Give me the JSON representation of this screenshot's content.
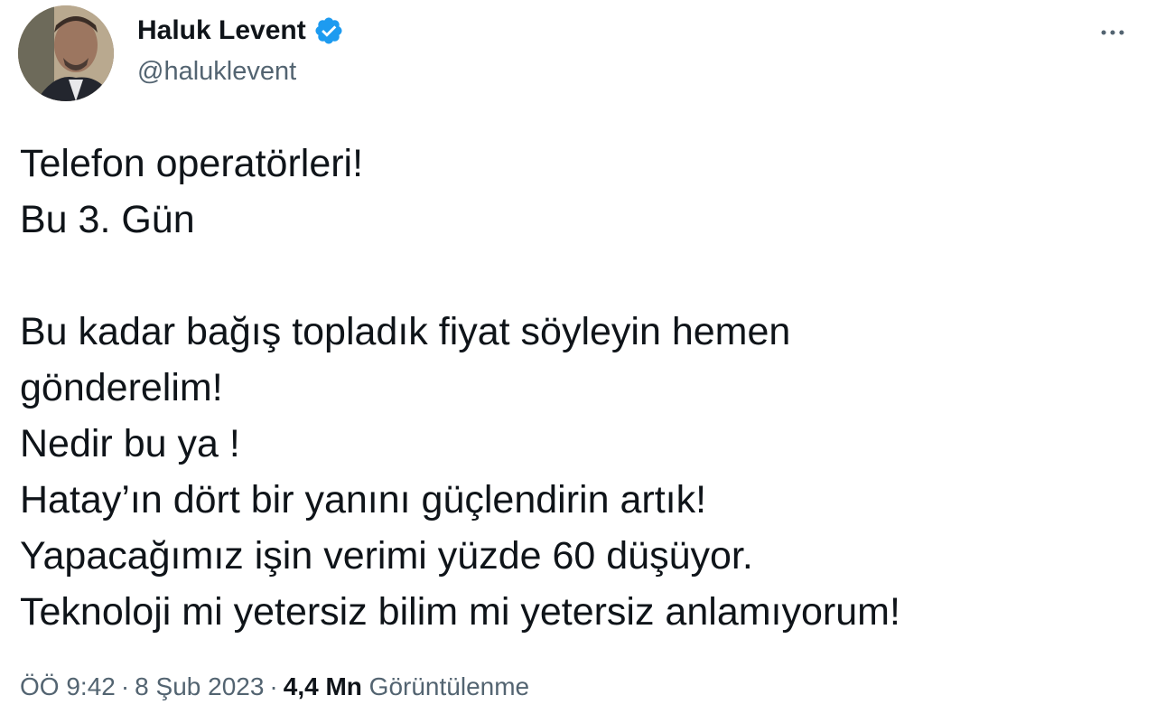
{
  "author": {
    "name": "Haluk Levent",
    "handle": "@haluklevent",
    "verified_color": "#1d9bf0"
  },
  "tweet": {
    "lines": [
      "Telefon operatörleri!",
      "Bu 3. Gün",
      "",
      "Bu kadar bağış topladık fiyat söyleyin hemen",
      "gönderelim!",
      "Nedir bu ya !",
      "Hatay’ın dört bir yanını güçlendirin artık!",
      "Yapacağımız işin verimi yüzde 60 düşüyor.",
      "Teknoloji mi yetersiz bilim mi yetersiz anlamıyorum!"
    ]
  },
  "meta": {
    "time": "ÖÖ 9:42",
    "separator": "·",
    "date": "8 Şub 2023",
    "views_count": "4,4 Mn",
    "views_label": "Görüntülenme"
  },
  "icons": {
    "more": "more-horizontal-icon",
    "verified": "verified-badge-icon"
  }
}
